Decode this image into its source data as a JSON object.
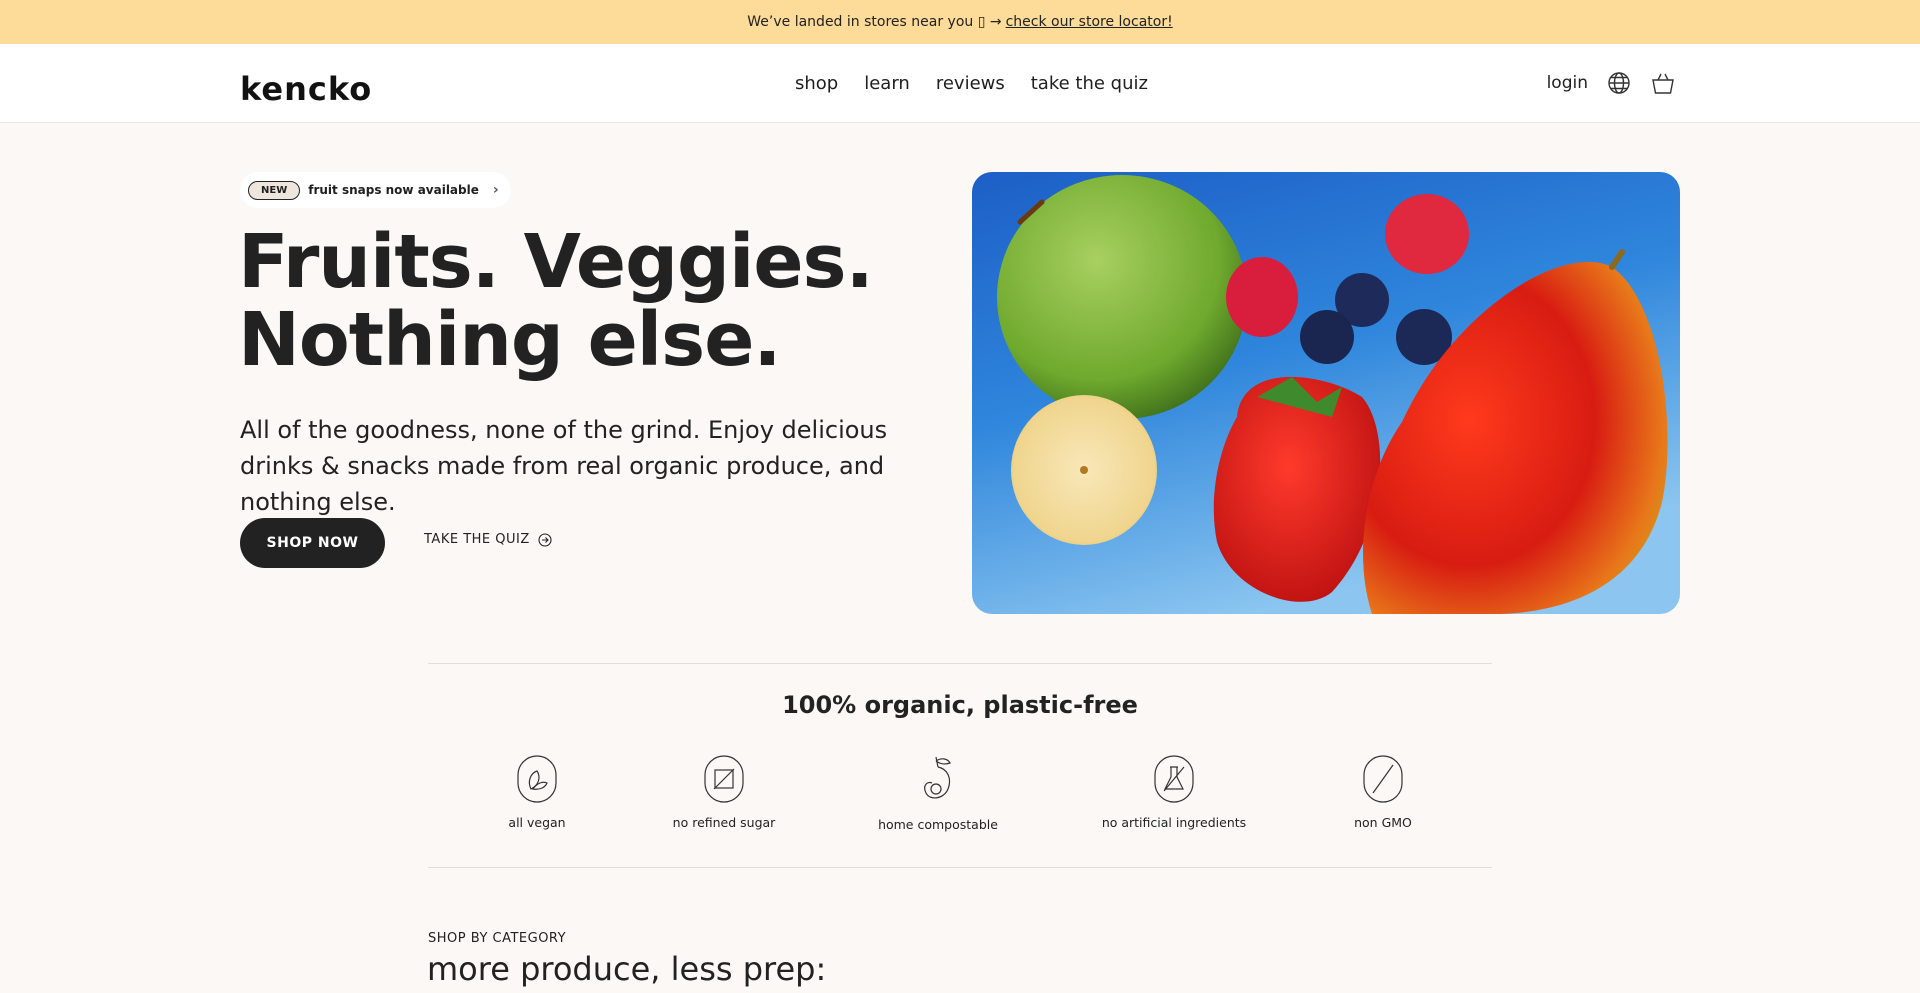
{
  "announcement": {
    "text": "We’ve landed in stores near you ▯ →",
    "link": "check our store locator!"
  },
  "header": {
    "logo": "kencko",
    "nav": [
      "shop",
      "learn",
      "reviews",
      "take the quiz"
    ],
    "login": "login",
    "icons": [
      "globe-icon",
      "cart-icon"
    ]
  },
  "hero": {
    "badge": "NEW",
    "promo": "fruit snaps now available",
    "title_line1": "Fruits. Veggies.",
    "title_line2": "Nothing else.",
    "subtitle": "All of the goodness, none of the grind. Enjoy delicious drinks & snacks made from real organic produce, and nothing else.",
    "cta_primary": "SHOP NOW",
    "cta_secondary": "TAKE THE QUIZ",
    "image_alt": "fruits"
  },
  "features": {
    "title": "100% organic, plastic-free",
    "items": [
      {
        "label": "all vegan",
        "icon": "leaf-icon"
      },
      {
        "label": "no refined sugar",
        "icon": "no-sugar-icon"
      },
      {
        "label": "home compostable",
        "icon": "compost-icon"
      },
      {
        "label": "no artificial ingredients",
        "icon": "flask-icon"
      },
      {
        "label": "non GMO",
        "icon": "non-gmo-icon"
      }
    ]
  },
  "categories": {
    "eyebrow": "SHOP BY CATEGORY",
    "title": "more produce, less prep:"
  },
  "colors": {
    "announcement_bg": "#fddb98",
    "page_bg": "#fbf8f5",
    "primary_button": "#222222"
  }
}
